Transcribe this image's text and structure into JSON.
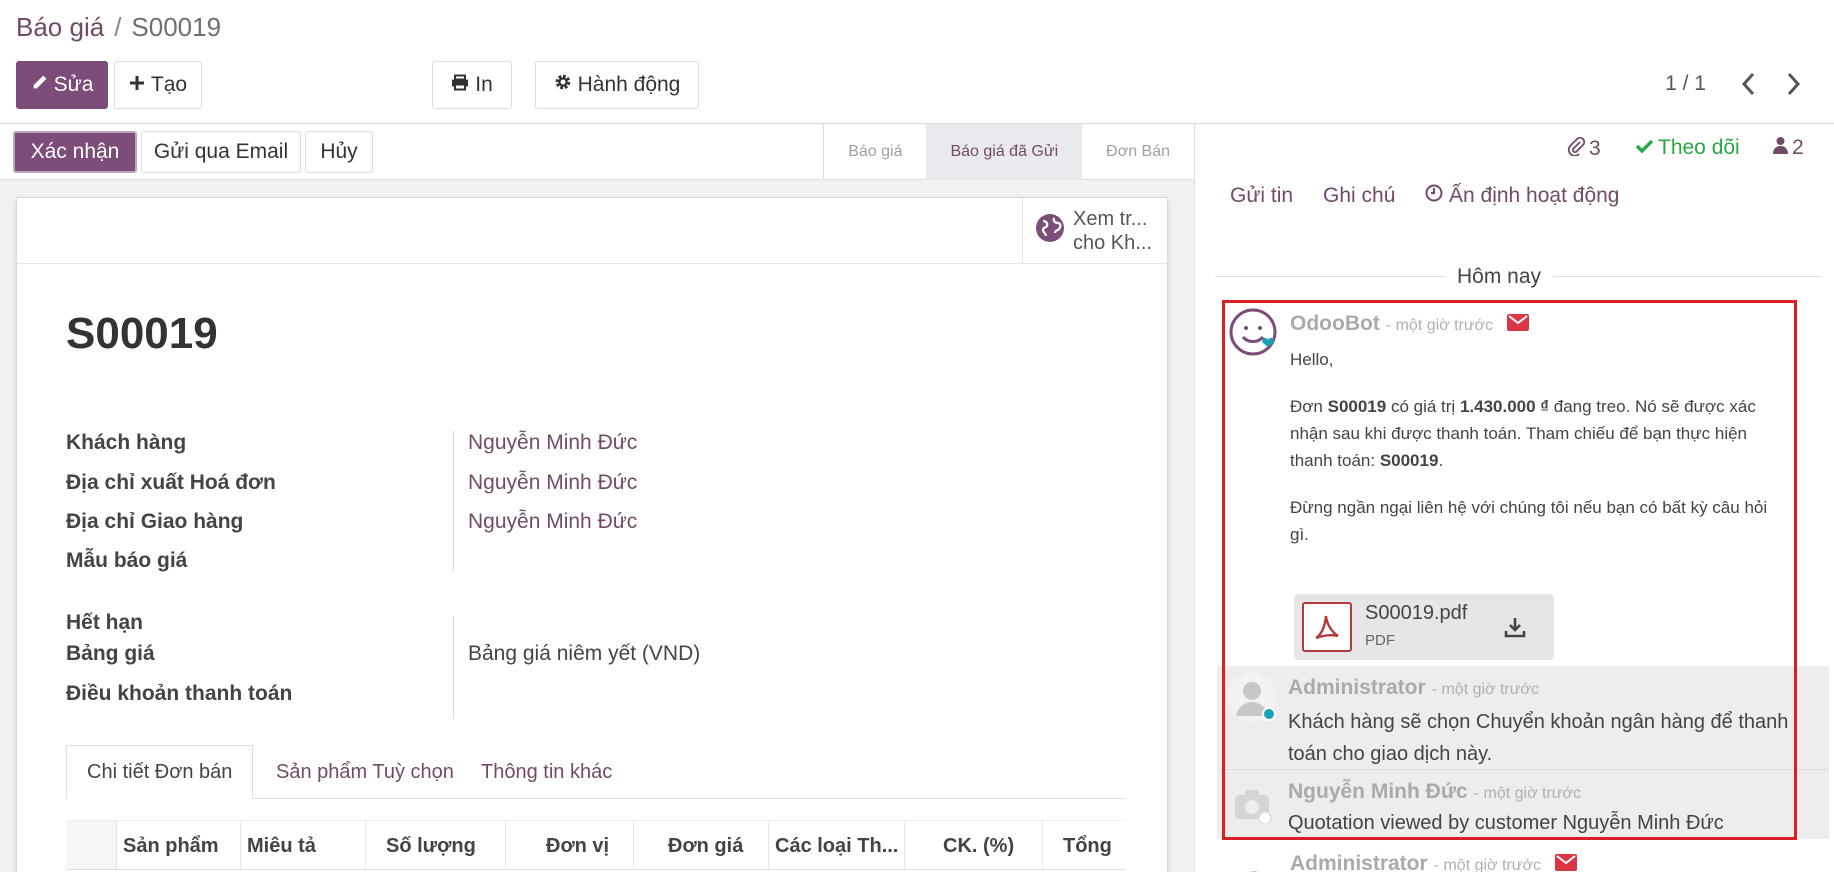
{
  "breadcrumb": {
    "parent": "Báo giá",
    "separator": "/",
    "current": "S00019"
  },
  "toolbar": {
    "edit_label": "Sửa",
    "create_label": "Tạo",
    "print_label": "In",
    "action_label": "Hành động",
    "pager": "1 / 1"
  },
  "statusbar": {
    "confirm_label": "Xác nhận",
    "email_label": "Gửi qua Email",
    "cancel_label": "Hủy",
    "stages": [
      "Báo giá",
      "Báo giá đã Gửi",
      "Đơn Bán"
    ],
    "active_stage": "Báo giá đã Gửi"
  },
  "sheet": {
    "preview_line1": "Xem tr...",
    "preview_line2": "cho Kh...",
    "title": "S00019",
    "fields": [
      {
        "label": "Khách hàng",
        "value": "Nguyễn Minh Đức"
      },
      {
        "label": "Địa chỉ xuất Hoá đơn",
        "value": "Nguyễn Minh Đức"
      },
      {
        "label": "Địa chỉ Giao hàng",
        "value": "Nguyễn Minh Đức"
      },
      {
        "label": "Mẫu báo giá",
        "value": ""
      },
      {
        "label": "Hết hạn",
        "value": ""
      },
      {
        "label": "Bảng giá",
        "value": "Bảng giá niêm yết (VND)"
      },
      {
        "label": "Điều khoản thanh toán",
        "value": ""
      }
    ],
    "tabs": [
      "Chi tiết Đơn bán",
      "Sản phẩm Tuỳ chọn",
      "Thông tin khác"
    ],
    "columns": [
      "Sản phẩm",
      "Miêu tả",
      "Số lượng",
      "Đơn vị",
      "Đơn giá",
      "Các loại Th...",
      "CK. (%)",
      "Tổng"
    ]
  },
  "chatter": {
    "attachments_count": "3",
    "follow_label": "Theo dõi",
    "followers_count": "2",
    "send_message": "Gửi tin",
    "log_note": "Ghi chú",
    "schedule_activity": "Ấn định hoạt động",
    "today": "Hôm nay",
    "messages": [
      {
        "author": "OdooBot",
        "when": "- một giờ trước",
        "greeting": "Hello,",
        "p1_a": "Đơn ",
        "p1_order": "S00019",
        "p1_b": " có giá trị ",
        "p1_amount": "1.430.000 ₫",
        "p1_c": " đang treo. Nó sẽ được xác nhận sau khi được thanh toán. Tham chiếu để bạn thực hiện thanh toán: ",
        "p1_ref": "S00019",
        "p1_d": ".",
        "p2": "Đừng ngần ngại liên hệ với chúng tôi nếu bạn có bất kỳ câu hỏi gì.",
        "attachment_name": "S00019.pdf",
        "attachment_type": "PDF"
      },
      {
        "author": "Administrator",
        "when": "- một giờ trước",
        "body": "Khách hàng sẽ chọn Chuyển khoản ngân hàng để thanh toán cho giao dịch này."
      },
      {
        "author": "Nguyễn Minh Đức",
        "when": "- một giờ trước",
        "body": "Quotation viewed by customer Nguyễn Minh Đức"
      },
      {
        "author": "Administrator",
        "when": "- một giờ trước"
      }
    ]
  },
  "colors": {
    "primary": "#714b67",
    "button": "#7c4d78",
    "follow": "#28a745",
    "email_badge": "#dc3545",
    "highlight_box": "#dc1f26"
  }
}
